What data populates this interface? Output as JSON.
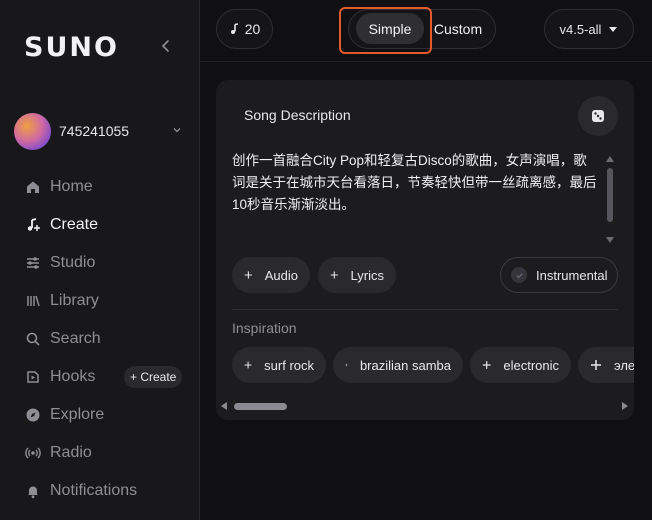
{
  "sidebar": {
    "logo": "SUNO",
    "user": {
      "name": "745241055"
    },
    "items": [
      {
        "label": "Home",
        "icon": "home-icon",
        "active": false
      },
      {
        "label": "Create",
        "icon": "music-note-icon",
        "active": true
      },
      {
        "label": "Studio",
        "icon": "sliders-icon",
        "active": false
      },
      {
        "label": "Library",
        "icon": "library-icon",
        "active": false
      },
      {
        "label": "Search",
        "icon": "search-icon",
        "active": false
      },
      {
        "label": "Hooks",
        "icon": "hooks-icon",
        "active": false,
        "badge": "+ Create"
      },
      {
        "label": "Explore",
        "icon": "compass-icon",
        "active": false
      },
      {
        "label": "Radio",
        "icon": "radio-icon",
        "active": false
      },
      {
        "label": "Notifications",
        "icon": "bell-icon",
        "active": false
      }
    ]
  },
  "topbar": {
    "credits": "20",
    "mode_simple": "Simple",
    "mode_custom": "Custom",
    "active_mode": "Simple",
    "version": "v4.5-all"
  },
  "panel": {
    "description_label": "Song Description",
    "description_text": "创作一首融合City Pop和轻复古Disco的歌曲，女声演唱，歌词是关于在城市天台看落日，节奏轻快但带一丝疏离感，最后10秒音乐渐渐淡出。",
    "buttons": {
      "audio": "Audio",
      "lyrics": "Lyrics",
      "instrumental": "Instrumental"
    },
    "inspiration_label": "Inspiration",
    "tags": [
      "surf rock",
      "brazilian samba",
      "electronic",
      "эле"
    ]
  },
  "colors": {
    "background": "#101012",
    "sidebar": "#18181a",
    "panel": "#1c1c1f",
    "pill": "#2a2a2e",
    "highlight": "#e05a2e"
  }
}
